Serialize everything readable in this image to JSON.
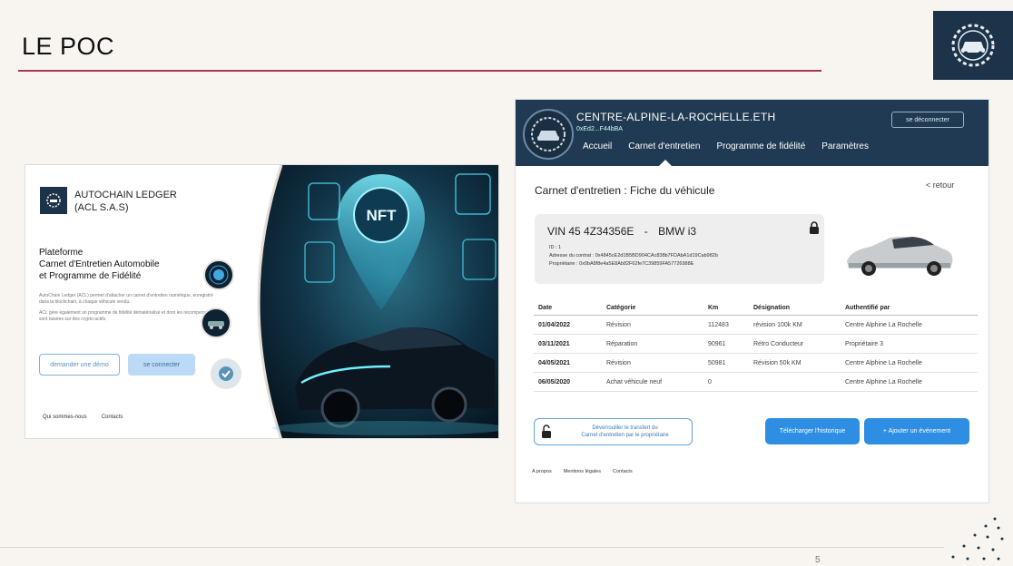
{
  "slide": {
    "title": "LE POC",
    "page_number": "5"
  },
  "colors": {
    "accent_rule": "#a33a52",
    "navy": "#1f3a52",
    "primary_button": "#2d8ee3"
  },
  "left_app": {
    "brand_line1": "AUTOCHAIN LEDGER",
    "brand_line2": "(ACL S.A.S)",
    "heading_line1": "Plateforme",
    "heading_line2": "Carnet d'Entretien Automobile",
    "heading_line3": "et Programme de Fidélité",
    "description_1": "AutoChain Ledger (ACL) permet d'attacher un carnet d'entretien numérique, enregistré dans la blockchain, à chaque véhicule vendu.",
    "description_2": "ACL gère également un programme de fidélité dématérialisé et dont les récompenses sont basées sur des crypto-actifs.",
    "demo_button": "demander une démo",
    "login_button": "se connecter",
    "footer_about": "Qui sommes-nous",
    "footer_contacts": "Contacts",
    "hero_badge": "NFT"
  },
  "right_app": {
    "ens_name": "CENTRE-ALPINE-LA-ROCHELLE.ETH",
    "wallet_short": "0xEd2...F44bBA",
    "logout_button": "se déconnecter",
    "nav": [
      "Accueil",
      "Carnet d'entretien",
      "Programme de fidélité",
      "Paramètres"
    ],
    "page_title": "Carnet d'entretien : Fiche du véhicule",
    "back_link": "< retour",
    "vin": "VIN 45 4Z34356E",
    "separator": "-",
    "model": "BMW i3",
    "vehicle_id": "ID : 1",
    "contract_address": "Adresse du contrat : 0x4845cE2d1B5BD904CAc838b7FDAbA1d19Cab982b",
    "owner": "Propriétaire : 0x0bA8f8e4a5E8Ab82F62fe7C39859FA57726988E",
    "table": {
      "headers": [
        "Date",
        "Catégorie",
        "Km",
        "Désignation",
        "Authentifié par"
      ],
      "rows": [
        [
          "01/04/2022",
          "Révision",
          "112483",
          "révision 100k KM",
          "Centre Alphine La Rochelle"
        ],
        [
          "03/11/2021",
          "Réparation",
          "90961",
          "Rétro Conducteur",
          "Propriétaire 3"
        ],
        [
          "04/05/2021",
          "Révision",
          "50981",
          "Révision 50k KM",
          "Centre Alphine La Rochelle"
        ],
        [
          "06/05/2020",
          "Achat véhicule neuf",
          "0",
          "",
          "Centre Alphine La Rochelle"
        ]
      ]
    },
    "unlock_button_line1": "Déverrouiller le transfert du",
    "unlock_button_line2": "Carnet d'entretien par le propriétaire",
    "download_button": "Télécharger l'historique",
    "add_event_button": "+ Ajouter un événement",
    "footer": [
      "A propos",
      "Mentions légales",
      "Contacts"
    ]
  }
}
